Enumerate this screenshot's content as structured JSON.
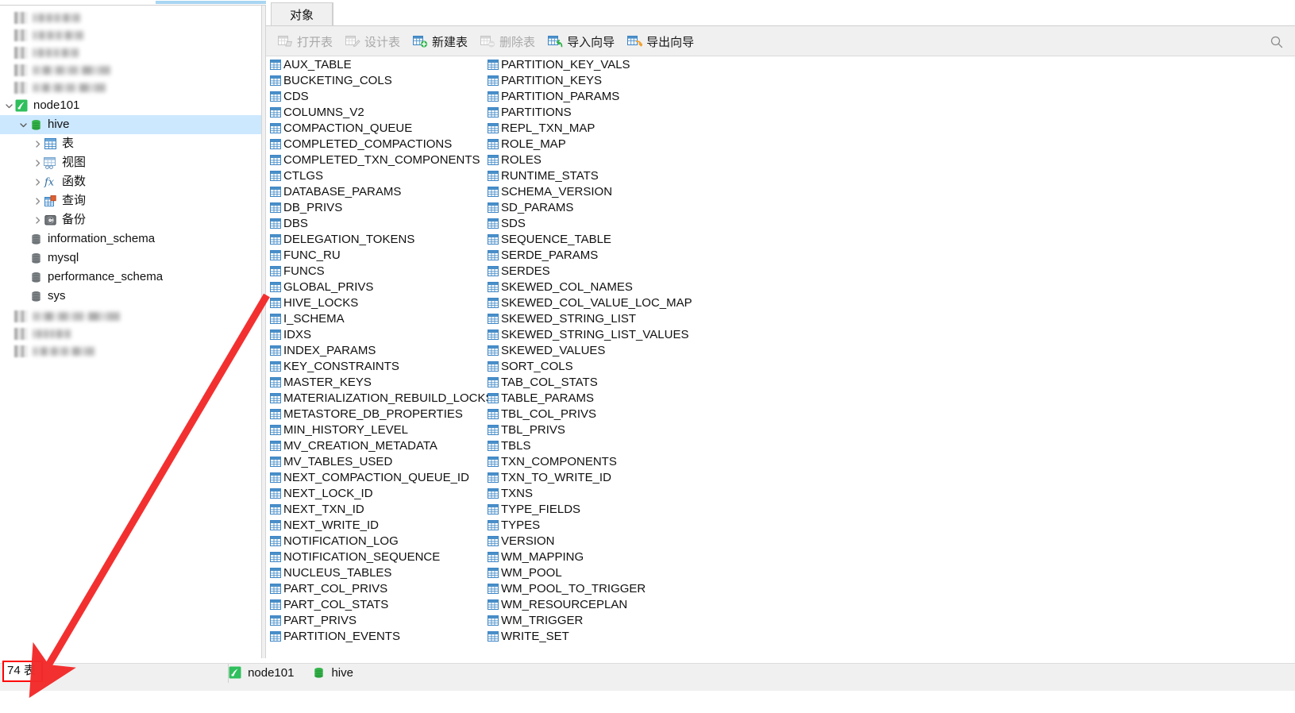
{
  "window": {
    "accent_selection": "#cce8ff",
    "annotation_color": "#ff0000"
  },
  "sidebar": {
    "blurred_top_items": [
      "",
      "",
      "",
      "",
      ""
    ],
    "blurred_bottom_items": [
      "",
      "",
      ""
    ],
    "connection": {
      "label": "node101",
      "icon": "navicat-connection-icon",
      "expanded": true
    },
    "database": {
      "label": "hive",
      "icon": "database-icon",
      "expanded": true,
      "selected": true
    },
    "db_children": [
      {
        "label": "表",
        "icon": "table-icon"
      },
      {
        "label": "视图",
        "icon": "view-icon"
      },
      {
        "label": "函数",
        "icon": "function-icon"
      },
      {
        "label": "查询",
        "icon": "query-icon"
      },
      {
        "label": "备份",
        "icon": "backup-icon"
      }
    ],
    "other_databases": [
      {
        "label": "information_schema",
        "icon": "database-icon"
      },
      {
        "label": "mysql",
        "icon": "database-icon"
      },
      {
        "label": "performance_schema",
        "icon": "database-icon"
      },
      {
        "label": "sys",
        "icon": "database-icon"
      }
    ]
  },
  "tabs": [
    {
      "label": "对象",
      "active": true
    }
  ],
  "toolbar": {
    "buttons": [
      {
        "label": "打开表",
        "icon": "open-table-icon",
        "enabled": false
      },
      {
        "label": "设计表",
        "icon": "design-table-icon",
        "enabled": false
      },
      {
        "label": "新建表",
        "icon": "new-table-icon",
        "enabled": true
      },
      {
        "label": "删除表",
        "icon": "delete-table-icon",
        "enabled": false
      },
      {
        "label": "导入向导",
        "icon": "import-wizard-icon",
        "enabled": true
      },
      {
        "label": "导出向导",
        "icon": "export-wizard-icon",
        "enabled": true
      }
    ],
    "search_icon": "search-icon"
  },
  "tables": {
    "column1": [
      "AUX_TABLE",
      "BUCKETING_COLS",
      "CDS",
      "COLUMNS_V2",
      "COMPACTION_QUEUE",
      "COMPLETED_COMPACTIONS",
      "COMPLETED_TXN_COMPONENTS",
      "CTLGS",
      "DATABASE_PARAMS",
      "DB_PRIVS",
      "DBS",
      "DELEGATION_TOKENS",
      "FUNC_RU",
      "FUNCS",
      "GLOBAL_PRIVS",
      "HIVE_LOCKS",
      "I_SCHEMA",
      "IDXS",
      "INDEX_PARAMS",
      "KEY_CONSTRAINTS",
      "MASTER_KEYS",
      "MATERIALIZATION_REBUILD_LOCKS",
      "METASTORE_DB_PROPERTIES",
      "MIN_HISTORY_LEVEL",
      "MV_CREATION_METADATA",
      "MV_TABLES_USED",
      "NEXT_COMPACTION_QUEUE_ID",
      "NEXT_LOCK_ID",
      "NEXT_TXN_ID",
      "NEXT_WRITE_ID",
      "NOTIFICATION_LOG",
      "NOTIFICATION_SEQUENCE",
      "NUCLEUS_TABLES",
      "PART_COL_PRIVS",
      "PART_COL_STATS",
      "PART_PRIVS",
      "PARTITION_EVENTS"
    ],
    "column2": [
      "PARTITION_KEY_VALS",
      "PARTITION_KEYS",
      "PARTITION_PARAMS",
      "PARTITIONS",
      "REPL_TXN_MAP",
      "ROLE_MAP",
      "ROLES",
      "RUNTIME_STATS",
      "SCHEMA_VERSION",
      "SD_PARAMS",
      "SDS",
      "SEQUENCE_TABLE",
      "SERDE_PARAMS",
      "SERDES",
      "SKEWED_COL_NAMES",
      "SKEWED_COL_VALUE_LOC_MAP",
      "SKEWED_STRING_LIST",
      "SKEWED_STRING_LIST_VALUES",
      "SKEWED_VALUES",
      "SORT_COLS",
      "TAB_COL_STATS",
      "TABLE_PARAMS",
      "TBL_COL_PRIVS",
      "TBL_PRIVS",
      "TBLS",
      "TXN_COMPONENTS",
      "TXN_TO_WRITE_ID",
      "TXNS",
      "TYPE_FIELDS",
      "TYPES",
      "VERSION",
      "WM_MAPPING",
      "WM_POOL",
      "WM_POOL_TO_TRIGGER",
      "WM_RESOURCEPLAN",
      "WM_TRIGGER",
      "WRITE_SET"
    ]
  },
  "status_bar": {
    "count_label": "74 表",
    "connection": {
      "label": "node101",
      "icon": "navicat-connection-icon"
    },
    "database": {
      "label": "hive",
      "icon": "database-icon"
    }
  }
}
